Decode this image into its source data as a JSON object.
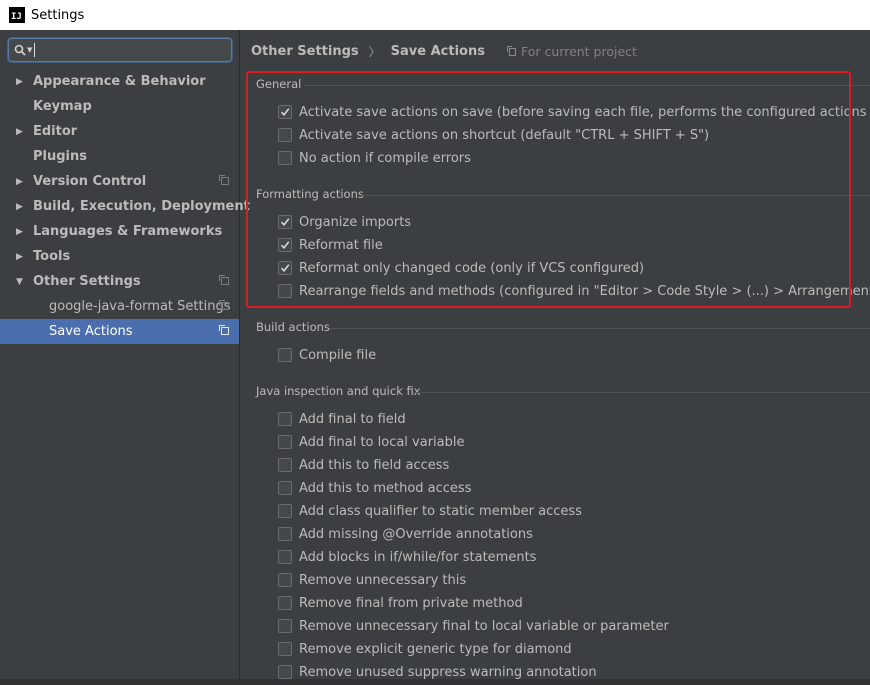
{
  "window": {
    "title": "Settings",
    "app_icon": "IJ"
  },
  "sidebar": {
    "search": {
      "value": "",
      "placeholder": ""
    },
    "items": [
      {
        "label": "Appearance & Behavior",
        "arrow": "right"
      },
      {
        "label": "Keymap"
      },
      {
        "label": "Editor",
        "arrow": "right"
      },
      {
        "label": "Plugins"
      },
      {
        "label": "Version Control",
        "arrow": "right",
        "copy_icon": true
      },
      {
        "label": "Build, Execution, Deployment",
        "arrow": "right"
      },
      {
        "label": "Languages & Frameworks",
        "arrow": "right"
      },
      {
        "label": "Tools",
        "arrow": "right"
      },
      {
        "label": "Other Settings",
        "arrow": "down",
        "copy_icon": true
      },
      {
        "label": "google-java-format Settings",
        "child": true,
        "copy_icon": true
      },
      {
        "label": "Save Actions",
        "child": true,
        "selected": true,
        "copy_icon": true
      }
    ]
  },
  "main": {
    "breadcrumb": {
      "parent": "Other Settings",
      "separator": "〉",
      "current": "Save Actions",
      "scope": "For current project"
    },
    "sections": [
      {
        "title": "General",
        "options": [
          {
            "label": "Activate save actions on save (before saving each file, performs the configured actions below)",
            "checked": true
          },
          {
            "label": "Activate save actions on shortcut (default \"CTRL + SHIFT + S\")",
            "checked": false
          },
          {
            "label": "No action if compile errors",
            "checked": false
          }
        ]
      },
      {
        "title": "Formatting actions",
        "options": [
          {
            "label": "Organize imports",
            "checked": true
          },
          {
            "label": "Reformat file",
            "checked": true
          },
          {
            "label": "Reformat only changed code (only if VCS configured)",
            "checked": true
          },
          {
            "label": "Rearrange fields and methods (configured in \"Editor > Code Style > (...) > Arrangement\")",
            "checked": false
          }
        ]
      },
      {
        "title": "Build actions",
        "options": [
          {
            "label": "Compile file",
            "checked": false
          }
        ]
      },
      {
        "title": "Java inspection and quick fix",
        "options": [
          {
            "label": "Add final to field",
            "checked": false
          },
          {
            "label": "Add final to local variable",
            "checked": false
          },
          {
            "label": "Add this to field access",
            "checked": false
          },
          {
            "label": "Add this to method access",
            "checked": false
          },
          {
            "label": "Add class qualifier to static member access",
            "checked": false
          },
          {
            "label": "Add missing @Override annotations",
            "checked": false
          },
          {
            "label": "Add blocks in if/while/for statements",
            "checked": false
          },
          {
            "label": "Remove unnecessary this",
            "checked": false
          },
          {
            "label": "Remove final from private method",
            "checked": false
          },
          {
            "label": "Remove unnecessary final to local variable or parameter",
            "checked": false
          },
          {
            "label": "Remove explicit generic type for diamond",
            "checked": false
          },
          {
            "label": "Remove unused suppress warning annotation",
            "checked": false
          }
        ]
      }
    ]
  },
  "colors": {
    "accent": "#4b6eaf",
    "highlight_border": "#e0191f",
    "background": "#3c3f41"
  }
}
